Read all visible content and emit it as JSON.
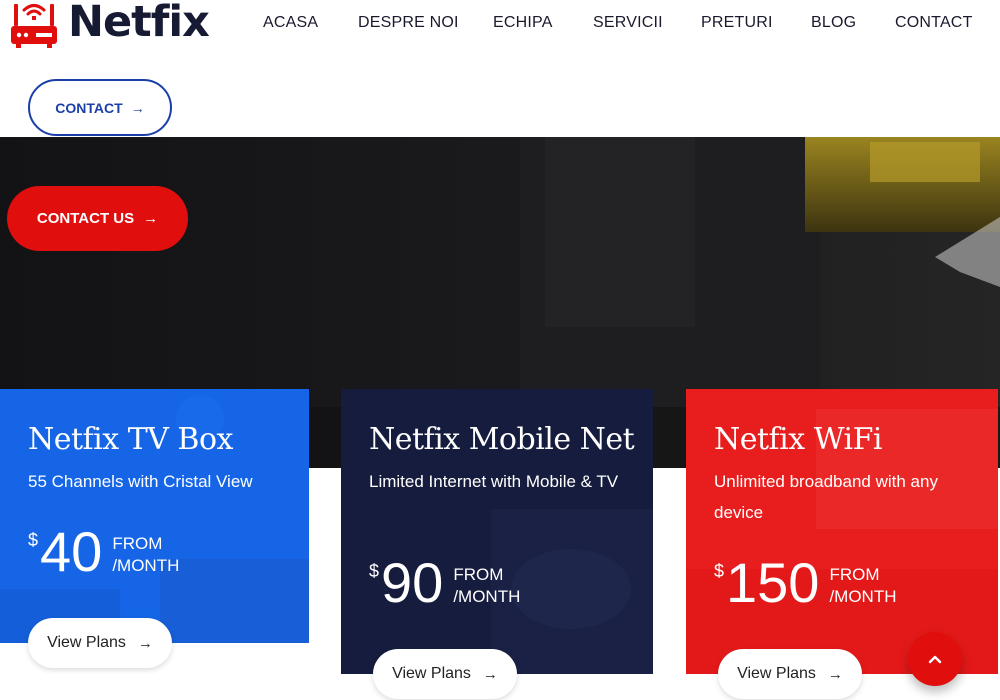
{
  "brand": {
    "name": "Netfix",
    "primary": "#e10e0e",
    "dark": "#161a33",
    "blue": "#1565e6"
  },
  "nav": {
    "items": [
      {
        "label": "ACASA"
      },
      {
        "label": "DESPRE NOI"
      },
      {
        "label": "ECHIPA"
      },
      {
        "label": "SERVICII"
      },
      {
        "label": "PRETURI"
      },
      {
        "label": "BLOG"
      },
      {
        "label": "CONTACT"
      }
    ]
  },
  "header_button": {
    "label": "CONTACT",
    "icon": "arrow-right-icon"
  },
  "hero": {
    "button_label": "CONTACT US",
    "icon": "arrow-right-icon"
  },
  "cards": [
    {
      "title": "Netfix TV Box",
      "description": "55 Channels with Cristal View",
      "currency": "$",
      "price": "40",
      "from": "FROM",
      "period": "/MONTH",
      "button": "View Plans",
      "color": "#1565e6"
    },
    {
      "title": "Netfix Mobile Net",
      "description": "Limited Internet with Mobile & TV",
      "currency": "$",
      "price": "90",
      "from": "FROM",
      "period": "/MONTH",
      "button": "View Plans",
      "color": "#161c3d"
    },
    {
      "title": "Netfix WiFi",
      "description": "Unlimited broadband with any device",
      "currency": "$",
      "price": "150",
      "from": "FROM",
      "period": "/MONTH",
      "button": "View Plans",
      "color": "#e81d1d"
    }
  ],
  "scroll_top": {
    "icon": "chevron-up-icon"
  }
}
